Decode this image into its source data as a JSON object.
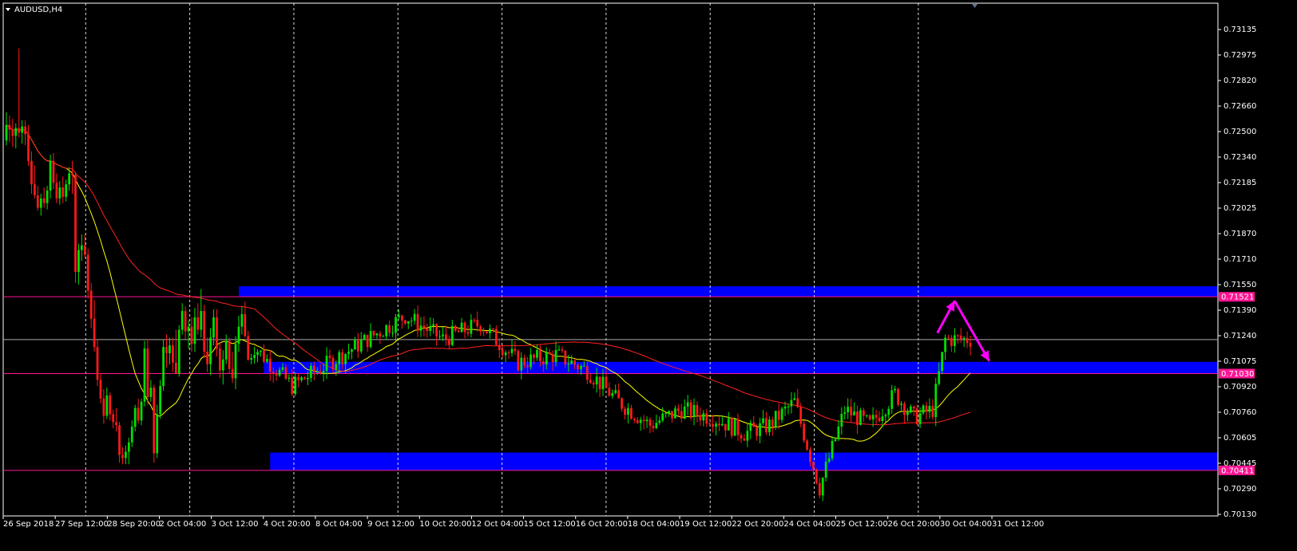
{
  "window": {
    "title": "AUDUSD,H4"
  },
  "colors": {
    "background": "#000000",
    "axis": "#ffffff",
    "grid": "#ffffff",
    "bull_candle": "#00e000",
    "bear_candle": "#ff1a1a",
    "fast_ma": "#ffff00",
    "slow_ma": "#ff2020",
    "zone": "#0000ff",
    "level_line": "#ff1493",
    "current_price_line": "#a9a9a9",
    "arrow": "#ff00ff"
  },
  "chart_data": {
    "type": "candlestick",
    "symbol": "AUDUSD",
    "timeframe": "H4",
    "ylim": [
      0.7013,
      0.7323
    ],
    "y_ticks": [
      "0.73135",
      "0.72975",
      "0.72820",
      "0.72660",
      "0.72500",
      "0.72340",
      "0.72185",
      "0.72025",
      "0.71870",
      "0.71710",
      "0.71550",
      "0.71390",
      "0.71240",
      "0.71075",
      "0.70920",
      "0.70760",
      "0.70605",
      "0.70445",
      "0.70290",
      "0.70130"
    ],
    "x_ticks": [
      "26 Sep 2018",
      "27 Sep 12:00",
      "28 Sep 20:00",
      "2 Oct 04:00",
      "3 Oct 12:00",
      "4 Oct 20:00",
      "8 Oct 04:00",
      "9 Oct 12:00",
      "10 Oct 20:00",
      "12 Oct 04:00",
      "15 Oct 12:00",
      "16 Oct 20:00",
      "18 Oct 04:00",
      "19 Oct 12:00",
      "22 Oct 20:00",
      "24 Oct 04:00",
      "25 Oct 12:00",
      "26 Oct 20:00",
      "30 Oct 04:00",
      "31 Oct 12:00"
    ],
    "grid": "vertical dashed lines at every second date tick",
    "price_levels": [
      {
        "label": "0.71521",
        "value": 0.71521
      },
      {
        "label": "0.71030",
        "value": 0.7103
      },
      {
        "label": "0.70411",
        "value": 0.70411
      }
    ],
    "current_price": 0.71247,
    "zones": [
      {
        "start_bar": 74,
        "top": 0.71588,
        "bottom": 0.71521
      },
      {
        "start_bar": 82,
        "top": 0.71105,
        "bottom": 0.7103
      },
      {
        "start_bar": 84,
        "top": 0.70525,
        "bottom": 0.70411
      }
    ],
    "arrows": [
      {
        "from_bar": 296.5,
        "from_price": 0.7129,
        "to_bar": 302,
        "to_price": 0.71495
      },
      {
        "from_bar": 302,
        "from_price": 0.71495,
        "to_bar": 313,
        "to_price": 0.7111
      }
    ],
    "indicators": [
      {
        "type": "moving_average",
        "role": "fast",
        "color": "#ffff00"
      },
      {
        "type": "moving_average",
        "role": "slow",
        "color": "#ff2020"
      }
    ],
    "candles": [
      [
        0.7252,
        0.727,
        0.7249,
        0.7262
      ],
      [
        0.7262,
        0.7268,
        0.7251,
        0.7259
      ],
      [
        0.7259,
        0.7266,
        0.7248,
        0.7255
      ],
      [
        0.7255,
        0.7263,
        0.7247,
        0.726
      ],
      [
        0.726,
        0.7311,
        0.7254,
        0.7257
      ],
      [
        0.7257,
        0.7265,
        0.725,
        0.7261
      ],
      [
        0.7261,
        0.7265,
        0.7249,
        0.7256
      ],
      [
        0.7256,
        0.7262,
        0.7236,
        0.7239
      ],
      [
        0.7239,
        0.7245,
        0.7218,
        0.7224
      ],
      [
        0.7224,
        0.7236,
        0.7215,
        0.7217
      ],
      [
        0.7217,
        0.7223,
        0.7207,
        0.7209
      ],
      [
        0.7209,
        0.7218,
        0.7204,
        0.7215
      ],
      [
        0.7215,
        0.7222,
        0.7209,
        0.7212
      ],
      [
        0.7212,
        0.7223,
        0.7208,
        0.722
      ],
      [
        0.722,
        0.7243,
        0.7215,
        0.7239
      ],
      [
        0.7239,
        0.7244,
        0.7221,
        0.7225
      ],
      [
        0.7225,
        0.7231,
        0.7212,
        0.7215
      ],
      [
        0.7215,
        0.7226,
        0.7211,
        0.7222
      ],
      [
        0.7222,
        0.7229,
        0.7212,
        0.7216
      ],
      [
        0.7216,
        0.7227,
        0.7213,
        0.7224
      ],
      [
        0.7224,
        0.7235,
        0.722,
        0.7231
      ],
      [
        0.7231,
        0.7239,
        0.7218,
        0.723
      ],
      [
        0.723,
        0.7232,
        0.7161,
        0.7168
      ],
      [
        0.7168,
        0.7186,
        0.716,
        0.7182
      ],
      [
        0.7182,
        0.7192,
        0.7175,
        0.7185
      ],
      [
        0.7185,
        0.7192,
        0.7177,
        0.7179
      ],
      [
        0.7179,
        0.7183,
        0.7151,
        0.7156
      ],
      [
        0.7156,
        0.7161,
        0.7132,
        0.7138
      ],
      [
        0.7138,
        0.715,
        0.7117,
        0.712
      ],
      [
        0.712,
        0.7125,
        0.7095,
        0.7099
      ],
      [
        0.7099,
        0.7103,
        0.7084,
        0.7087
      ],
      [
        0.7087,
        0.7093,
        0.7071,
        0.7076
      ],
      [
        0.7076,
        0.7094,
        0.7074,
        0.7089
      ],
      [
        0.7089,
        0.7091,
        0.7073,
        0.7077
      ],
      [
        0.7077,
        0.708,
        0.7068,
        0.7072
      ],
      [
        0.7072,
        0.7081,
        0.7066,
        0.707
      ],
      [
        0.707,
        0.7072,
        0.7046,
        0.7051
      ],
      [
        0.7051,
        0.7056,
        0.7045,
        0.7049
      ],
      [
        0.7049,
        0.7057,
        0.7045,
        0.7053
      ],
      [
        0.7053,
        0.7062,
        0.7045,
        0.7059
      ],
      [
        0.7059,
        0.7073,
        0.7056,
        0.7069
      ],
      [
        0.7069,
        0.7083,
        0.7066,
        0.7081
      ],
      [
        0.7081,
        0.7087,
        0.7071,
        0.7073
      ],
      [
        0.7073,
        0.7087,
        0.707,
        0.7085
      ],
      [
        0.7085,
        0.7124,
        0.7082,
        0.7119
      ],
      [
        0.7119,
        0.7125,
        0.7083,
        0.7088
      ],
      [
        0.7088,
        0.7099,
        0.7085,
        0.7094
      ],
      [
        0.7094,
        0.7096,
        0.7046,
        0.7052
      ],
      [
        0.7052,
        0.7083,
        0.7049,
        0.7077
      ],
      [
        0.7077,
        0.7099,
        0.7074,
        0.7095
      ],
      [
        0.7095,
        0.7125,
        0.7092,
        0.712
      ],
      [
        0.712,
        0.7128,
        0.7107,
        0.7116
      ],
      [
        0.7116,
        0.7126,
        0.7109,
        0.7121
      ],
      [
        0.7121,
        0.7126,
        0.7104,
        0.711
      ],
      [
        0.711,
        0.7131,
        0.7105,
        0.7103
      ],
      [
        0.7103,
        0.7134,
        0.7101,
        0.7131
      ],
      [
        0.7131,
        0.7148,
        0.7128,
        0.7143
      ],
      [
        0.7143,
        0.7146,
        0.7125,
        0.713
      ],
      [
        0.713,
        0.7137,
        0.7119,
        0.7133
      ],
      [
        0.7133,
        0.7139,
        0.7117,
        0.7122
      ],
      [
        0.7122,
        0.7145,
        0.7117,
        0.7139
      ],
      [
        0.7139,
        0.7148,
        0.7128,
        0.7131
      ],
      [
        0.7131,
        0.7157,
        0.7126,
        0.7143
      ],
      [
        0.7143,
        0.7147,
        0.7113,
        0.7117
      ],
      [
        0.7117,
        0.7126,
        0.7104,
        0.7109
      ],
      [
        0.7109,
        0.7132,
        0.7102,
        0.7126
      ],
      [
        0.7126,
        0.7144,
        0.7121,
        0.7139
      ],
      [
        0.7139,
        0.7144,
        0.7114,
        0.7119
      ],
      [
        0.7119,
        0.7123,
        0.71,
        0.7105
      ],
      [
        0.7105,
        0.7118,
        0.7096,
        0.7112
      ],
      [
        0.7112,
        0.7128,
        0.7109,
        0.7124
      ],
      [
        0.7124,
        0.7126,
        0.7103,
        0.7106
      ],
      [
        0.7106,
        0.7117,
        0.7097,
        0.71
      ],
      [
        0.71,
        0.7127,
        0.7093,
        0.7122
      ],
      [
        0.7122,
        0.714,
        0.7117,
        0.7133
      ],
      [
        0.7133,
        0.7146,
        0.7128,
        0.7141
      ],
      [
        0.7141,
        0.7149,
        0.7126,
        0.7127
      ]
    ]
  }
}
